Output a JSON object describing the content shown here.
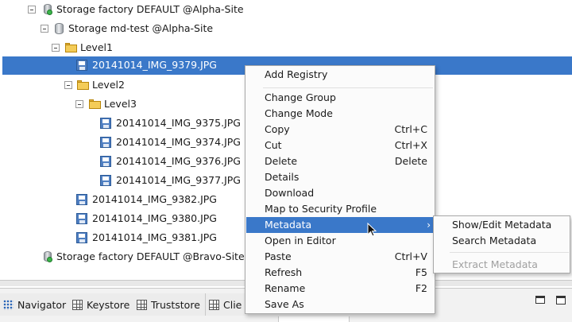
{
  "tree": {
    "nodes": [
      {
        "label": "Storage factory DEFAULT @Alpha-Site",
        "icon": "storage-factory-icon"
      },
      {
        "label": "Storage md-test @Alpha-Site",
        "icon": "storage-icon"
      },
      {
        "label": "Level1",
        "icon": "folder-icon"
      },
      {
        "label": "20141014_IMG_9379.JPG",
        "icon": "image-file-icon",
        "selected": true
      },
      {
        "label": "Level2",
        "icon": "folder-icon"
      },
      {
        "label": "Level3",
        "icon": "folder-icon"
      },
      {
        "label": "20141014_IMG_9375.JPG",
        "icon": "image-file-icon"
      },
      {
        "label": "20141014_IMG_9374.JPG",
        "icon": "image-file-icon"
      },
      {
        "label": "20141014_IMG_9376.JPG",
        "icon": "image-file-icon"
      },
      {
        "label": "20141014_IMG_9377.JPG",
        "icon": "image-file-icon"
      },
      {
        "label": "20141014_IMG_9382.JPG",
        "icon": "image-file-icon"
      },
      {
        "label": "20141014_IMG_9380.JPG",
        "icon": "image-file-icon"
      },
      {
        "label": "20141014_IMG_9381.JPG",
        "icon": "image-file-icon"
      },
      {
        "label": "Storage factory DEFAULT @Bravo-Site",
        "icon": "storage-factory-icon"
      }
    ]
  },
  "bottom_tabs": [
    {
      "label": "Navigator"
    },
    {
      "label": "Keystore"
    },
    {
      "label": "Truststore"
    },
    {
      "label": "Clie"
    }
  ],
  "context_menu": {
    "items": [
      {
        "label": "Add Registry",
        "shortcut": ""
      },
      {
        "label": "Change Group",
        "shortcut": ""
      },
      {
        "label": "Change Mode",
        "shortcut": ""
      },
      {
        "label": "Copy",
        "shortcut": "Ctrl+C"
      },
      {
        "label": "Cut",
        "shortcut": "Ctrl+X"
      },
      {
        "label": "Delete",
        "shortcut": "Delete"
      },
      {
        "label": "Details",
        "shortcut": ""
      },
      {
        "label": "Download",
        "shortcut": ""
      },
      {
        "label": "Map to Security Profile",
        "shortcut": ""
      },
      {
        "label": "Metadata",
        "shortcut": "",
        "submenu": true,
        "active": true
      },
      {
        "label": "Open in Editor",
        "shortcut": ""
      },
      {
        "label": "Paste",
        "shortcut": "Ctrl+V"
      },
      {
        "label": "Refresh",
        "shortcut": "F5"
      },
      {
        "label": "Rename",
        "shortcut": "F2"
      },
      {
        "label": "Save As",
        "shortcut": ""
      }
    ],
    "submenu_arrow": "›"
  },
  "metadata_submenu": {
    "items": [
      {
        "label": "Show/Edit Metadata",
        "enabled": true
      },
      {
        "label": "Search Metadata",
        "enabled": true
      },
      {
        "label": "Extract Metadata",
        "enabled": false
      }
    ]
  },
  "colors": {
    "selection": "#3a78c9",
    "folder": "#f4cc58",
    "file_icon": "#4f7fc2"
  }
}
